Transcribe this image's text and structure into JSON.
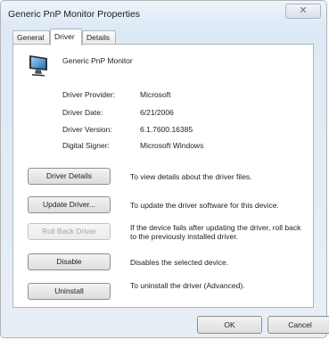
{
  "window": {
    "title": "Generic PnP Monitor Properties",
    "close_glyph": "✕"
  },
  "tabs": [
    {
      "label": "General"
    },
    {
      "label": "Driver"
    },
    {
      "label": "Details"
    }
  ],
  "active_tab": "Driver",
  "device": {
    "icon": "monitor-icon",
    "name": "Generic PnP Monitor"
  },
  "driver_info": [
    {
      "label": "Driver Provider:",
      "value": "Microsoft"
    },
    {
      "label": "Driver Date:",
      "value": "6/21/2006"
    },
    {
      "label": "Driver Version:",
      "value": "6.1.7600.16385"
    },
    {
      "label": "Digital Signer:",
      "value": "Microsoft Windows"
    }
  ],
  "actions": [
    {
      "label": "Driver Details",
      "description": "To view details about the driver files.",
      "enabled": true
    },
    {
      "label": "Update Driver...",
      "description": "To update the driver software for this device.",
      "enabled": true
    },
    {
      "label": "Roll Back Driver",
      "description": "If the device fails after updating the driver, roll back to the previously installed driver.",
      "enabled": false
    },
    {
      "label": "Disable",
      "description": "Disables the selected device.",
      "enabled": true
    },
    {
      "label": "Uninstall",
      "description": "To uninstall the driver (Advanced).",
      "enabled": true
    }
  ],
  "footer": {
    "ok_label": "OK",
    "cancel_label": "Cancel"
  }
}
